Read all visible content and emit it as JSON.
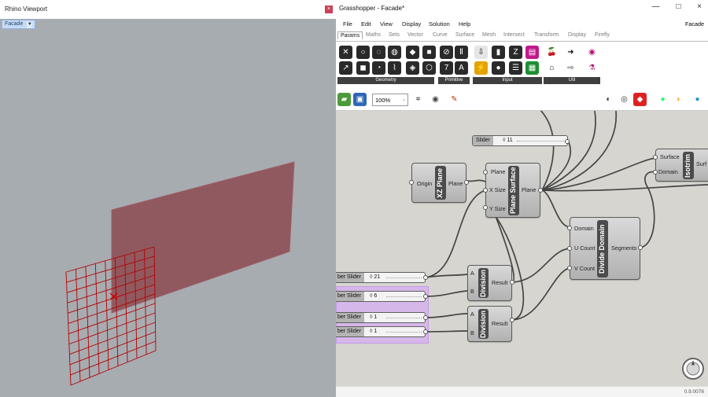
{
  "rhino": {
    "title": "Rhino Viewport",
    "close_icon": "close-icon",
    "viewport_tab": "Facade",
    "viewport_dropdown_icon": "chevron-down-icon"
  },
  "gh": {
    "title": "Grasshopper - Facade*",
    "document_name": "Facade",
    "menu": [
      "File",
      "Edit",
      "View",
      "Display",
      "Solution",
      "Help"
    ],
    "tabs": [
      "Params",
      "Maths",
      "Sets",
      "Vector",
      "Curve",
      "Surface",
      "Mesh",
      "Intersect",
      "Transform",
      "Display",
      "Firefly"
    ],
    "ribbon_groups": [
      "Geometry",
      "Primitive",
      "Input",
      "Util"
    ],
    "zoom": "100%",
    "status": "0.9.0076"
  },
  "canvas": {
    "slider_top": {
      "label": "Slider",
      "value": "11"
    },
    "xz_plane": {
      "name": "XZ Plane",
      "in": "Origin",
      "out": "Plane"
    },
    "plane_surface": {
      "name": "Plane Surface",
      "in": [
        "Plane",
        "X Size",
        "Y Size"
      ],
      "out": "Plane"
    },
    "divide_domain": {
      "name": "Divide Domain",
      "in": [
        "Domain",
        "U Count",
        "V Count"
      ],
      "out": "Segments"
    },
    "isotrim": {
      "name": "Isotrim",
      "in": [
        "Surface",
        "Domain"
      ],
      "out": "Surf"
    },
    "division1": {
      "name": "Division",
      "in": [
        "A",
        "B"
      ],
      "out": "Result"
    },
    "division2": {
      "name": "Division",
      "in": [
        "A",
        "B"
      ],
      "out": "Result"
    },
    "number_sliders": [
      {
        "label": "ber Slider",
        "value": "21"
      },
      {
        "label": "ber Slider",
        "value": "6"
      },
      {
        "label": "ber Slider",
        "value": "1"
      },
      {
        "label": "ber Slider",
        "value": "1"
      }
    ]
  },
  "colors": {
    "accent": "#c94359",
    "surface": "#8f4f53",
    "grid": "#b00000"
  }
}
